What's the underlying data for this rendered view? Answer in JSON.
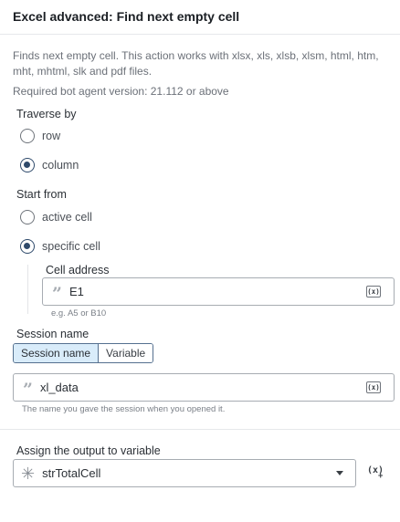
{
  "action": {
    "title": "Excel advanced: Find next empty cell",
    "description": "Finds next empty cell. This action works with xlsx, xls, xlsb, xlsm, html, htm, mht, mhtml, slk and pdf files.",
    "version": "Required bot agent version: 21.112 or above"
  },
  "traverse": {
    "label": "Traverse by",
    "options": [
      {
        "label": "row",
        "checked": false
      },
      {
        "label": "column",
        "checked": true
      }
    ]
  },
  "start_from": {
    "label": "Start from",
    "options": [
      {
        "label": "active cell",
        "checked": false
      },
      {
        "label": "specific cell",
        "checked": true
      }
    ]
  },
  "cell_address": {
    "label": "Cell address",
    "value": "E1",
    "hint": "e.g. A5 or B10",
    "var_icon": "(x)"
  },
  "session": {
    "label": "Session name",
    "tabs": [
      "Session name",
      "Variable"
    ],
    "active_tab": "Session name",
    "value": "xl_data",
    "hint": "The name you gave the session when you opened it.",
    "var_icon": "(x)"
  },
  "output": {
    "label": "Assign the output to variable",
    "value": "strTotalCell",
    "add_icon": "(x)",
    "add_icon_plus": "+"
  },
  "icons": {
    "quote": "quote-icon",
    "asterisk": "asterisk-icon",
    "caret": "chevron-down-icon",
    "variable": "variable-icon"
  },
  "colors": {
    "accent": "#2f4a6b",
    "tab_active_bg": "#d9ecfa",
    "border": "#a7acb2"
  }
}
